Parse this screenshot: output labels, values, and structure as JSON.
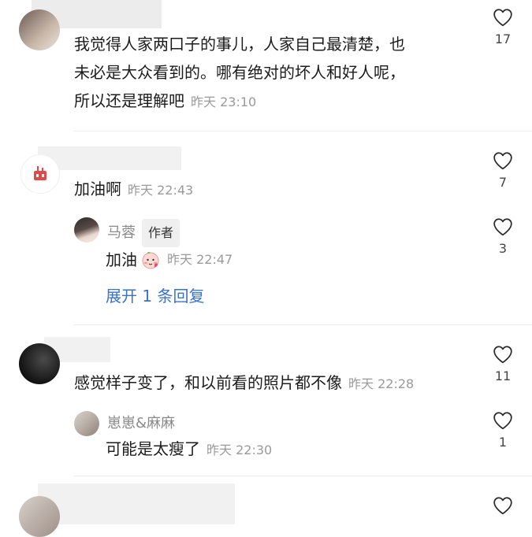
{
  "comments": [
    {
      "text_lines": [
        "我觉得人家两口子的事儿，人家自己最清楚，也",
        "未必是大众看到的。哪有绝对的坏人和好人呢，",
        "所以还是理解吧"
      ],
      "time": "昨天 23:10",
      "likes": "17"
    },
    {
      "text": "加油啊",
      "time": "昨天 22:43",
      "likes": "7",
      "reply": {
        "username": "马蓉",
        "badge": "作者",
        "text": "加油",
        "time": "昨天 22:47",
        "likes": "3"
      },
      "expand_label": "展开 1 条回复"
    },
    {
      "text": "感觉样子变了，和以前看的照片都不像",
      "time": "昨天 22:28",
      "likes": "11",
      "reply": {
        "username": "崽崽&麻麻",
        "text": "可能是太瘦了",
        "time": "昨天 22:30",
        "likes": "1"
      }
    }
  ],
  "icons": {
    "like": "heart-outline-icon",
    "emoji": "peach-emoji-icon"
  }
}
